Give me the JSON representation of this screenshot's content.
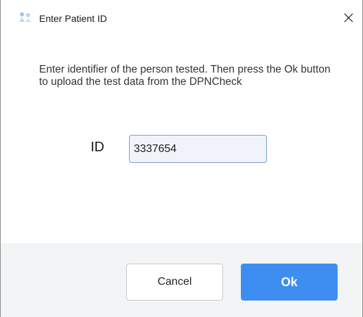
{
  "window": {
    "title": "Enter Patient ID",
    "app_icon": "patient-app-icon",
    "close_icon": "close-icon"
  },
  "dialog": {
    "message": "Enter identifier of the person tested. Then press the Ok button to upload the test data from the DPNCheck",
    "id_label": "ID",
    "id_value": "3337654"
  },
  "buttons": {
    "cancel_label": "Cancel",
    "ok_label": "Ok"
  },
  "colors": {
    "ok_button": "#3d8ef0",
    "footer_bg": "#f3f4f6",
    "input_border": "#7a9cc6"
  }
}
